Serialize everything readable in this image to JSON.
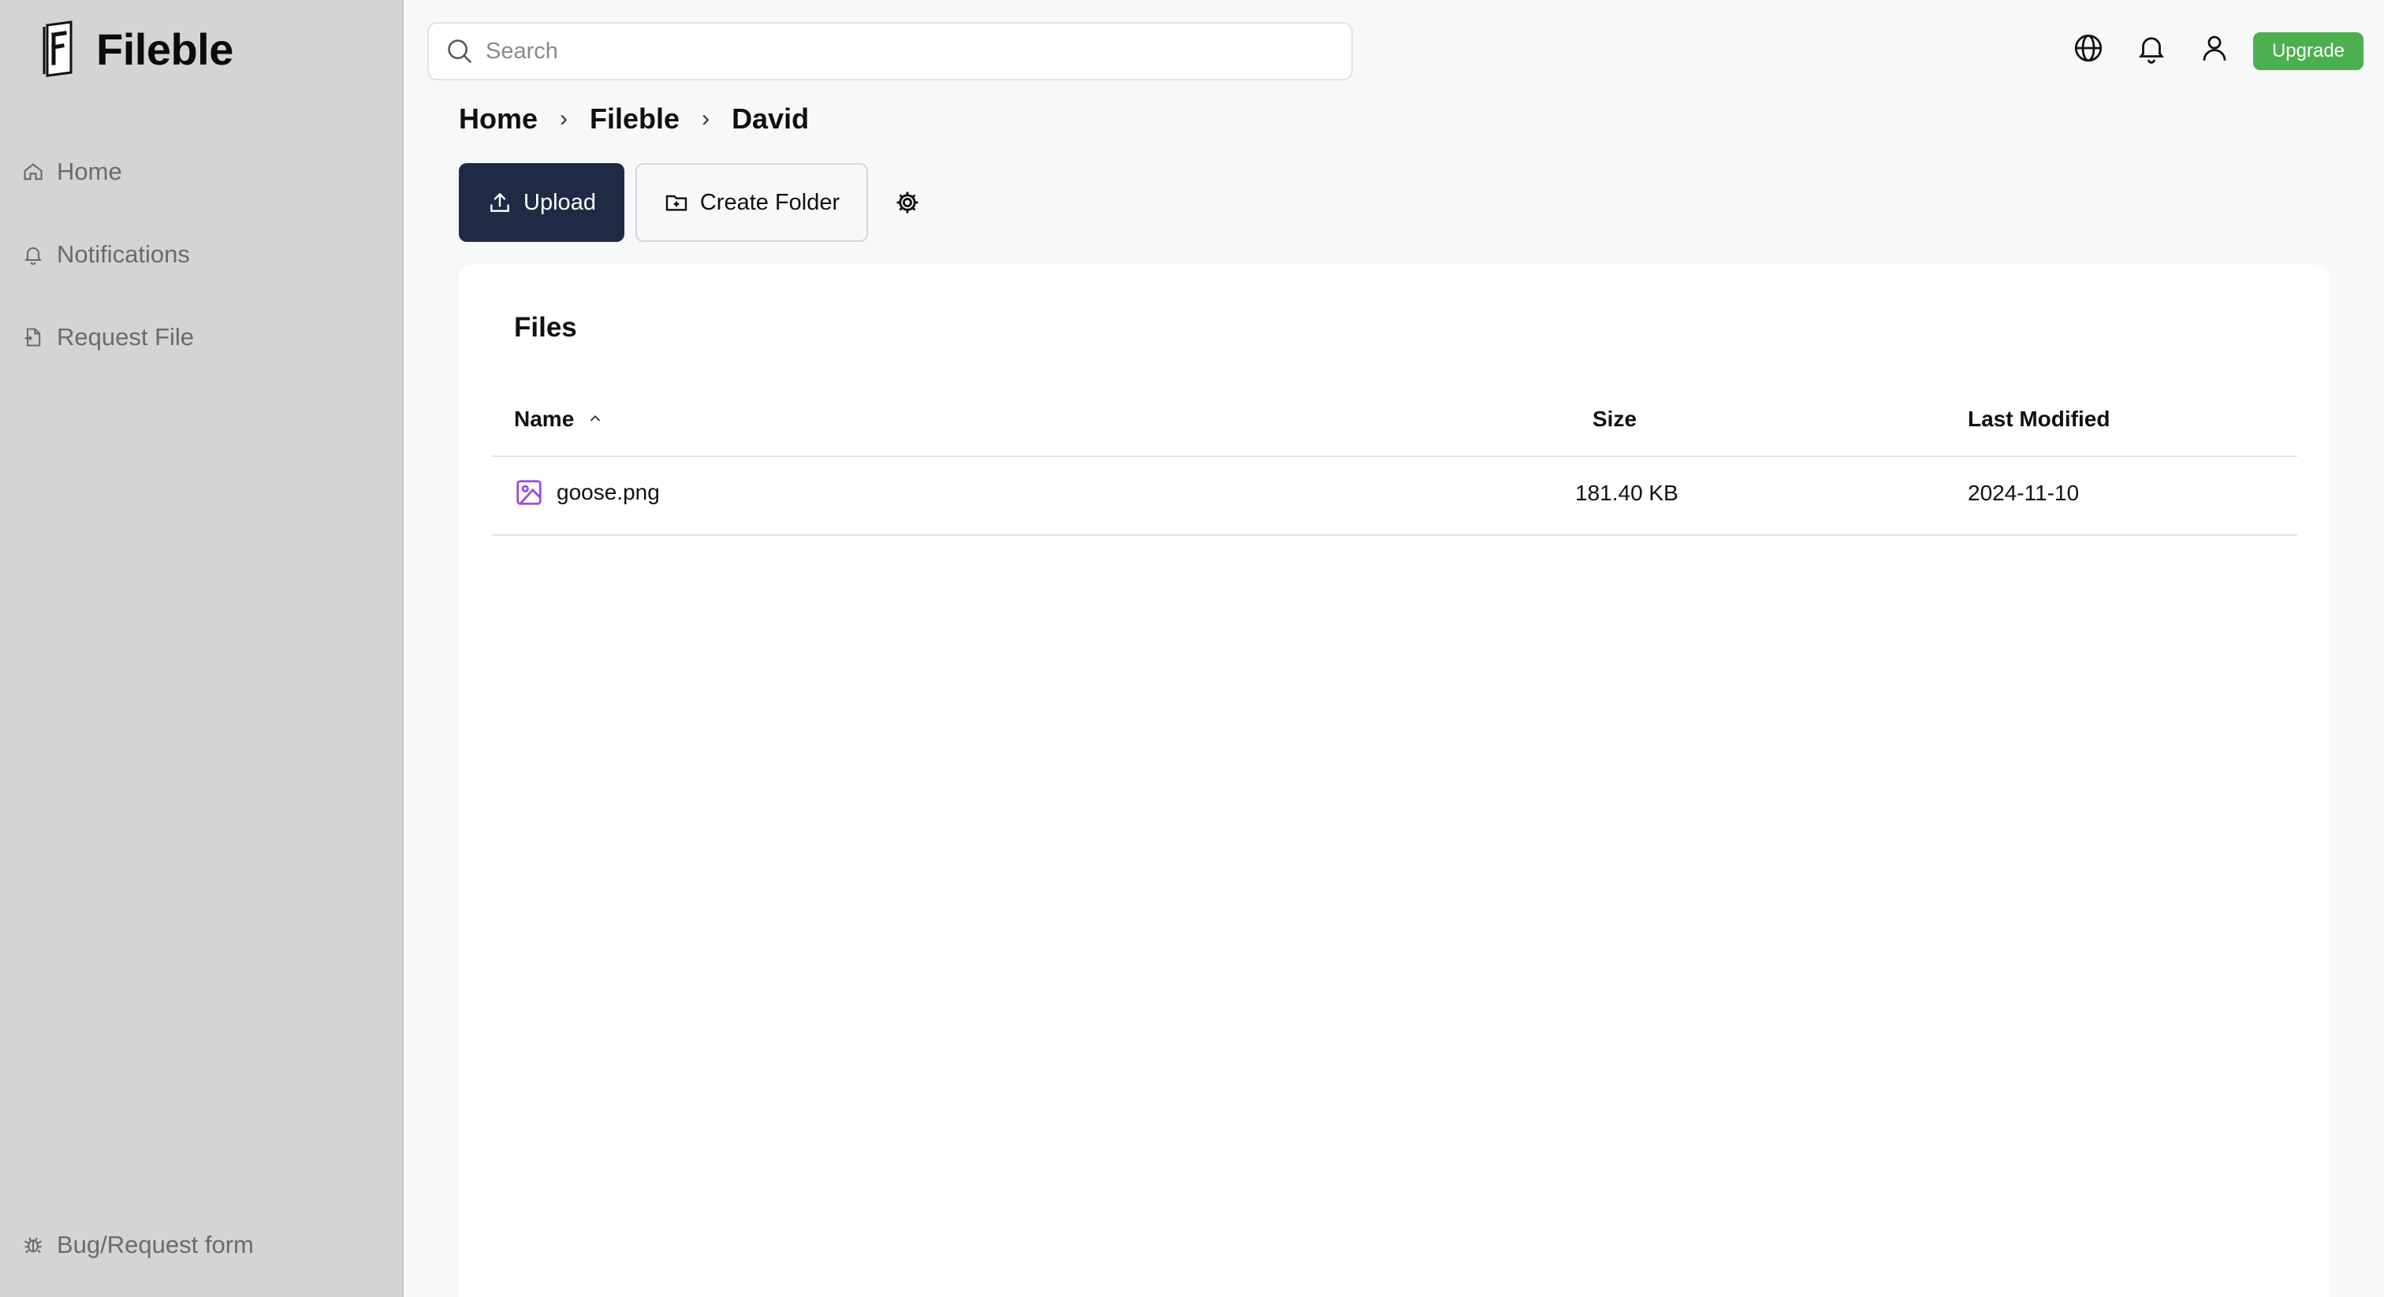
{
  "brand": {
    "name": "Fileble",
    "logo_letter": "F"
  },
  "sidebar": {
    "items": [
      {
        "label": "Home",
        "icon": "home-icon"
      },
      {
        "label": "Notifications",
        "icon": "bell-icon"
      },
      {
        "label": "Request File",
        "icon": "file-request-icon"
      }
    ],
    "footer": {
      "label": "Bug/Request form",
      "icon": "bug-icon"
    }
  },
  "search": {
    "placeholder": "Search",
    "value": ""
  },
  "topbar": {
    "icons": [
      "globe-icon",
      "bell-icon",
      "user-icon"
    ],
    "upgrade_label": "Upgrade",
    "upgrade_color": "#4caf50"
  },
  "breadcrumb": [
    "Home",
    "Fileble",
    "David"
  ],
  "actions": {
    "upload_label": "Upload",
    "create_folder_label": "Create Folder",
    "settings_icon": "gear-icon",
    "upload_color": "#1f2a44"
  },
  "files": {
    "title": "Files",
    "columns": {
      "name": "Name",
      "size": "Size",
      "modified": "Last Modified"
    },
    "sort": {
      "column": "Name",
      "direction": "ascending"
    },
    "rows": [
      {
        "name": "goose.png",
        "size": "181.40 KB",
        "modified": "2024-11-10",
        "icon": "image-file-icon"
      }
    ]
  }
}
